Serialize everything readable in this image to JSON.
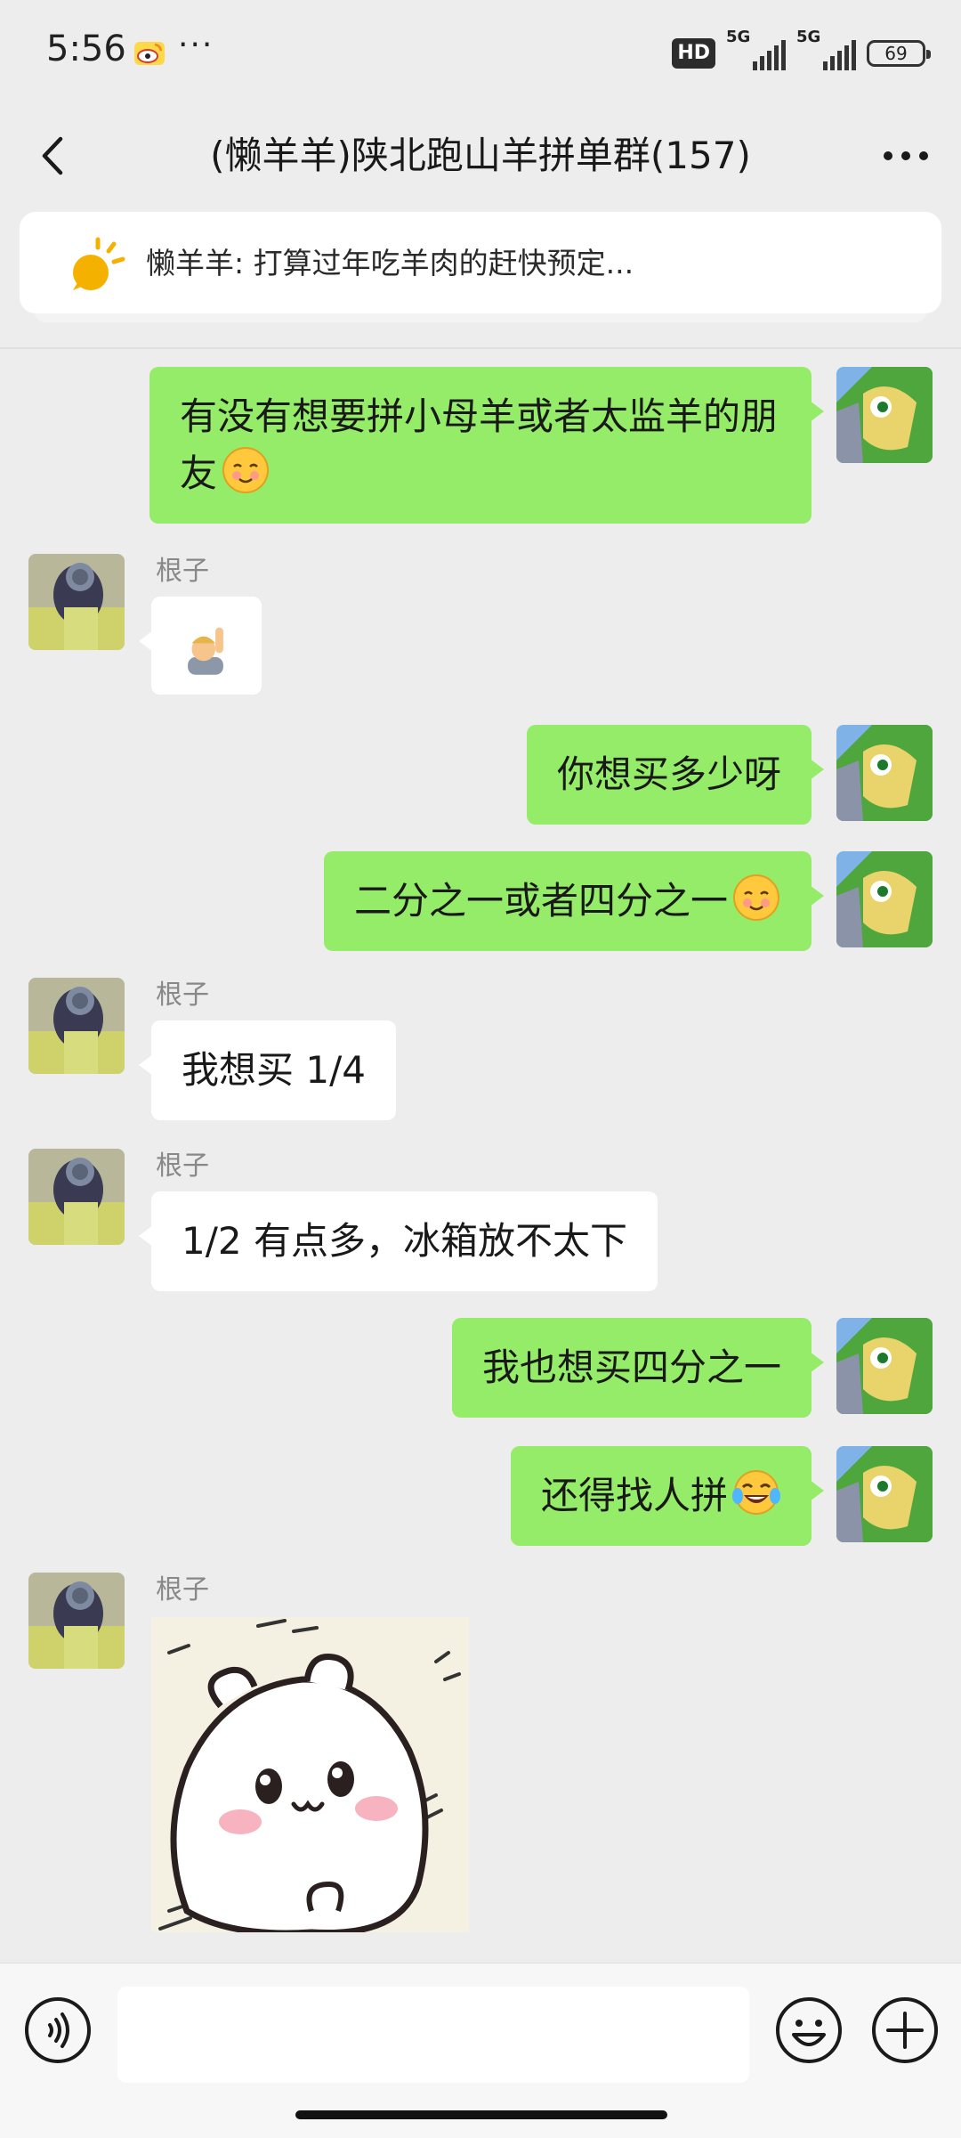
{
  "status_bar": {
    "time": "5:56",
    "more": "···",
    "hd": "HD",
    "network1": "5G",
    "network2": "5G",
    "battery": "69"
  },
  "header": {
    "title": "(懒羊羊)陕北跑山羊拼单群(157)"
  },
  "pinned": {
    "text": "懒羊羊: 打算过年吃羊肉的赶快预定..."
  },
  "messages": [
    {
      "side": "out",
      "text": "有没有想要拼小母羊或者太监羊的朋友",
      "emoji": "smiling-face"
    },
    {
      "side": "in",
      "sender": "根子",
      "emoji": "person-raising-hand"
    },
    {
      "side": "out",
      "text": "你想买多少呀"
    },
    {
      "side": "out",
      "text": "二分之一或者四分之一",
      "emoji": "smiling-face"
    },
    {
      "side": "in",
      "sender": "根子",
      "text": "我想买 1/4"
    },
    {
      "side": "in",
      "sender": "根子",
      "text": "1/2 有点多，冰箱放不太下"
    },
    {
      "side": "out",
      "text": "我也想买四分之一"
    },
    {
      "side": "out",
      "text": "还得找人拼",
      "emoji": "tears-of-joy"
    },
    {
      "side": "in",
      "sender": "根子",
      "sticker": "chiikawa-sticker"
    }
  ],
  "input": {
    "placeholder": ""
  },
  "colors": {
    "background": "#ededed",
    "outgoing_bubble": "#95ec69",
    "incoming_bubble": "#ffffff",
    "pin_icon": "#f5b100"
  }
}
